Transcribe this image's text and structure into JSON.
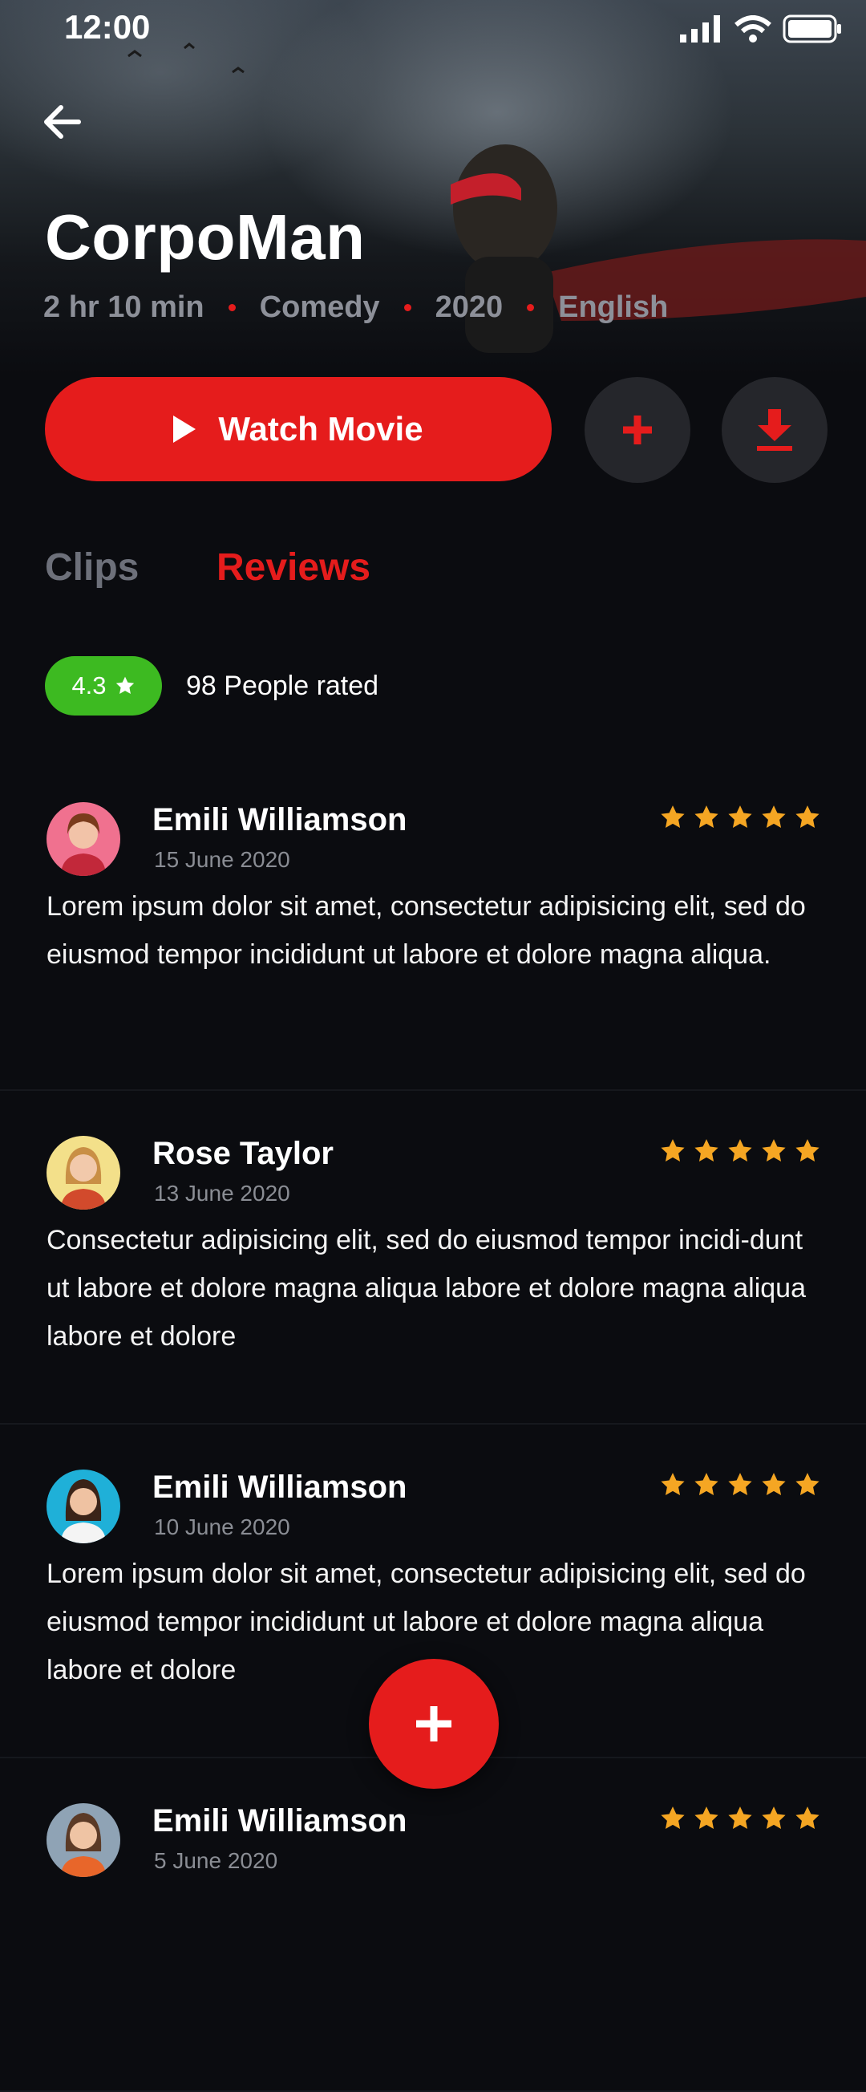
{
  "status_bar": {
    "time": "12:00"
  },
  "movie": {
    "title": "CorpoMan",
    "meta": [
      "2 hr 10 min",
      "Comedy",
      "2020",
      "English"
    ]
  },
  "actions": {
    "watch_label": "Watch Movie",
    "add_icon": "plus-icon",
    "download_icon": "download-icon"
  },
  "tabs": [
    {
      "label": "Clips",
      "active": false
    },
    {
      "label": "Reviews",
      "active": true
    }
  ],
  "rating": {
    "score": "4.3",
    "count_label": "98 People rated"
  },
  "reviews": [
    {
      "name": "Emili Williamson",
      "date": "15 June 2020",
      "stars": 5,
      "text": "Lorem ipsum dolor sit amet, consectetur adipisicing elit, sed do eiusmod tempor incididunt ut labore et dolore magna aliqua."
    },
    {
      "name": "Rose Taylor",
      "date": "13 June 2020",
      "stars": 5,
      "text": "Consectetur adipisicing elit, sed do eiusmod tempor incidi-dunt ut labore et dolore magna aliqua labore et dolore magna aliqua labore et dolore"
    },
    {
      "name": "Emili Williamson",
      "date": "10 June 2020",
      "stars": 5,
      "text": "Lorem ipsum dolor sit amet, consectetur adipisicing elit, sed do eiusmod tempor incididunt ut labore et dolore magna aliqua labore et dolore"
    },
    {
      "name": "Emili Williamson",
      "date": "5 June 2020",
      "stars": 5,
      "text": ""
    }
  ],
  "colors": {
    "accent": "#e51c1c",
    "rating_green": "#3dba21",
    "star": "#f5a623",
    "background": "#0b0c10"
  }
}
